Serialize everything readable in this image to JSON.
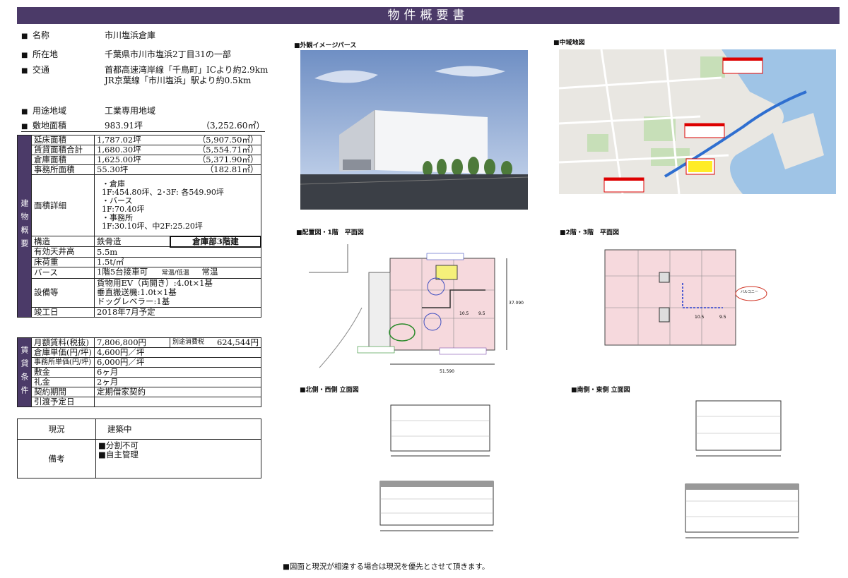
{
  "title": "物件概要書",
  "summary": [
    {
      "bullet": "■",
      "label": "名称",
      "value": "市川塩浜倉庫"
    },
    {
      "bullet": "■",
      "label": "所在地",
      "value": "千葉県市川市塩浜2丁目31の一部"
    },
    {
      "bullet": "■",
      "label": "交通",
      "value": "首都高速湾岸線「千鳥町」ICより約2.9km",
      "value2": "JR京葉線「市川塩浜」駅より約0.5km"
    }
  ],
  "zoning": {
    "bullet": "■",
    "label": "用途地域",
    "value": "工業専用地域"
  },
  "site": {
    "bullet": "■",
    "label": "敷地面積",
    "value": "983.91坪",
    "value_m2": "（3,252.60㎡）"
  },
  "building": {
    "side_label": "建物概要",
    "areas": [
      {
        "label": "延床面積",
        "tsubo": "1,787.02坪",
        "m2": "（5,907.50㎡）"
      },
      {
        "label": "賃貸面積合計",
        "tsubo": "1,680.30坪",
        "m2": "（5,554.71㎡）"
      },
      {
        "label": "倉庫面積",
        "tsubo": "1,625.00坪",
        "m2": "（5,371.90㎡）"
      },
      {
        "label": "事務所面積",
        "tsubo": "55.30坪",
        "m2": "（182.81㎡）"
      }
    ],
    "detail_label": "面積詳細",
    "detail_lines": [
      "・倉庫",
      "1F:454.80坪、2･3F: 各549.90坪",
      "・バース",
      "1F:70.40坪",
      "・事務所",
      "1F:30.10坪、中2F:25.20坪"
    ],
    "structure_label": "構造",
    "structure_value": "鉄骨造",
    "structure_note": "倉庫部3階建",
    "ceiling_label": "有効天井高",
    "ceiling_value": "5.5m",
    "load_label": "床荷重",
    "load_value": "1.5t/㎡",
    "berth_label": "バース",
    "berth_value": "1階5台接車可",
    "berth_temp_label": "常温/低温",
    "berth_temp_value": "常温",
    "equip_label": "設備等",
    "equip_lines": [
      "貨物用EV（両開き）:4.0t×1基",
      "垂直搬送機:1.0t×1基",
      "ドッグレベラー:1基"
    ],
    "complete_label": "竣工日",
    "complete_value": "2018年7月予定"
  },
  "lease": {
    "side_label": "賃貸条件",
    "rent_label": "月額賃料(税抜)",
    "rent_value": "7,806,800円",
    "tax_label": "別途消費税",
    "tax_value": "624,544円",
    "rows": [
      {
        "label": "倉庫単価(円/坪)",
        "value": "4,600円／坪"
      },
      {
        "label": "事務所単価(円/坪)",
        "value": "6,000円／坪"
      },
      {
        "label": "敷金",
        "value": "6ヶ月"
      },
      {
        "label": "礼金",
        "value": "2ヶ月"
      },
      {
        "label": "契約期間",
        "value": "定期借家契約"
      },
      {
        "label": "引渡予定日",
        "value": ""
      }
    ]
  },
  "status": {
    "label": "現況",
    "value": "建築中",
    "remarks_label": "備考",
    "remarks": [
      "■分割不可",
      "■自主管理"
    ]
  },
  "sections": {
    "perspective": "■外観イメージパース",
    "map": "■中域地図",
    "layout": "■配置図・1階　平面図",
    "floor23": "■2階・3階　平面図",
    "elev_nw": "■北側・西側 立面図",
    "elev_se": "■南側・東側 立面図"
  },
  "plan_labels": {
    "dim_width": "51.590",
    "dim_depth": "37.090",
    "bay1": "10.5",
    "bay2": "9.5",
    "balcony": "バルコニー"
  },
  "footer": "■図面と現況が相違する場合は現況を優先とさせて頂きます。",
  "colors": {
    "header": "#4b3a68",
    "plan_fill": "#f6d9dd"
  }
}
